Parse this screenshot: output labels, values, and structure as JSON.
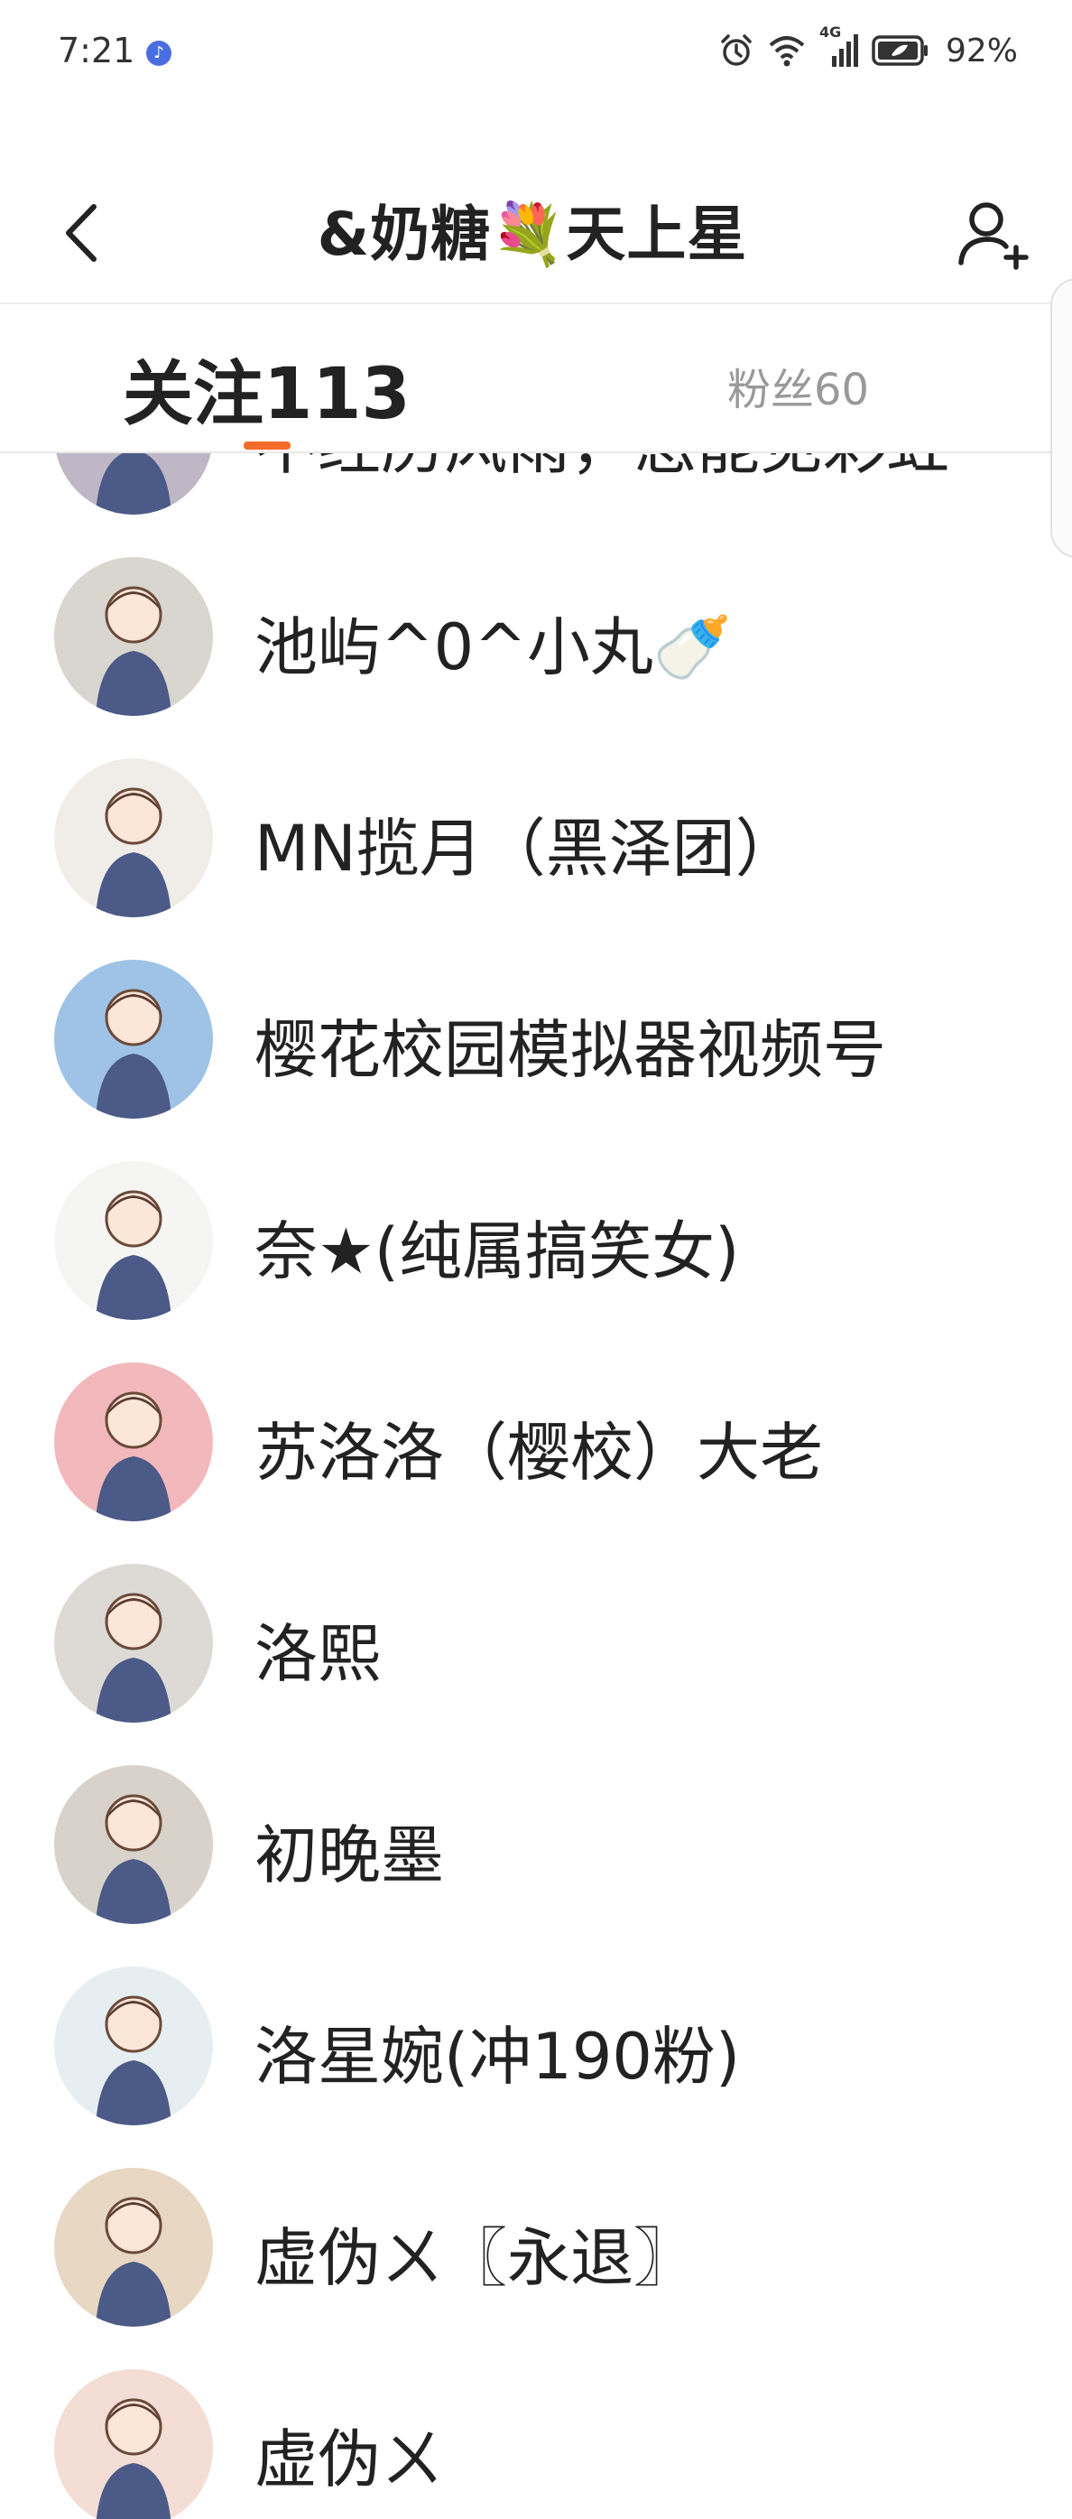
{
  "status_bar": {
    "time": "7:21",
    "network": "4G",
    "battery_percent": "92%"
  },
  "header": {
    "title": "&奶糖💐天上星"
  },
  "tabs": [
    {
      "label": "关注113",
      "active": true
    },
    {
      "label": "粉丝60",
      "active": false
    }
  ],
  "users": [
    {
      "name": "不经历风雨，怎能见彩虹",
      "avatar_bg": "#bfb7c6"
    },
    {
      "name": "池屿^0^小丸🍼",
      "avatar_bg": "#d9d5cf"
    },
    {
      "name": "MN揽月（黑泽团）",
      "avatar_bg": "#f0ece8"
    },
    {
      "name": "樱花校园模拟器视频号",
      "avatar_bg": "#9fc3e6"
    },
    {
      "name": "奈★(纯属搞笑女)",
      "avatar_bg": "#f5f5f3"
    },
    {
      "name": "苏洛洛（樱校）大老",
      "avatar_bg": "#f2b8bc"
    },
    {
      "name": "洛熙",
      "avatar_bg": "#dddad5"
    },
    {
      "name": "初晚墨",
      "avatar_bg": "#d8d2cb"
    },
    {
      "name": "洛星婉(冲190粉)",
      "avatar_bg": "#e6eef2"
    },
    {
      "name": "虚伪ㄨ〖永退〗",
      "avatar_bg": "#e8d7c3"
    },
    {
      "name": "虚伪ㄨ",
      "avatar_bg": "#f3ddd5"
    }
  ],
  "colors": {
    "accent": "#f56b2a",
    "text_primary": "#222222",
    "text_secondary": "#999999"
  }
}
